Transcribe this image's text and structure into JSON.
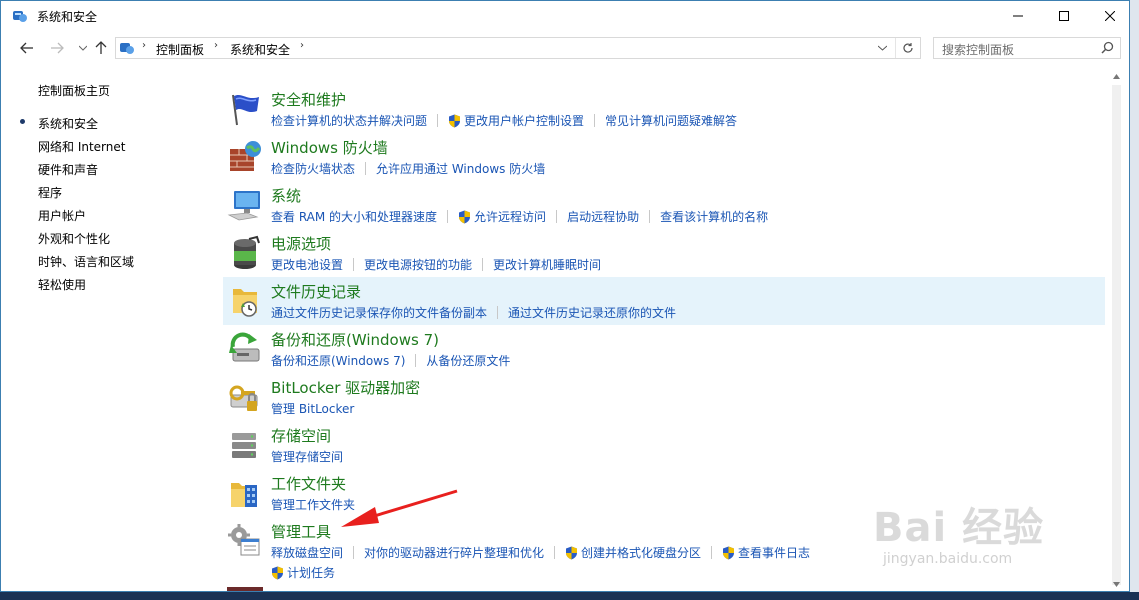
{
  "window": {
    "title": "系统和安全"
  },
  "address": {
    "crumbs": [
      "控制面板",
      "系统和安全"
    ]
  },
  "search": {
    "placeholder": "搜索控制面板"
  },
  "sidebar": {
    "home": "控制面板主页",
    "items": [
      {
        "label": "系统和安全",
        "current": true
      },
      {
        "label": "网络和 Internet"
      },
      {
        "label": "硬件和声音"
      },
      {
        "label": "程序"
      },
      {
        "label": "用户帐户"
      },
      {
        "label": "外观和个性化"
      },
      {
        "label": "时钟、语言和区域"
      },
      {
        "label": "轻松使用"
      }
    ]
  },
  "categories": [
    {
      "title": "安全和维护",
      "icon": "flag-icon",
      "links": [
        {
          "text": "检查计算机的状态并解决问题"
        },
        {
          "text": "更改用户帐户控制设置",
          "shield": true
        },
        {
          "text": "常见计算机问题疑难解答"
        }
      ]
    },
    {
      "title": "Windows 防火墙",
      "icon": "firewall-icon",
      "links": [
        {
          "text": "检查防火墙状态"
        },
        {
          "text": "允许应用通过 Windows 防火墙"
        }
      ]
    },
    {
      "title": "系统",
      "icon": "computer-icon",
      "links": [
        {
          "text": "查看 RAM 的大小和处理器速度"
        },
        {
          "text": "允许远程访问",
          "shield": true
        },
        {
          "text": "启动远程协助"
        },
        {
          "text": "查看该计算机的名称"
        }
      ]
    },
    {
      "title": "电源选项",
      "icon": "battery-icon",
      "links": [
        {
          "text": "更改电池设置"
        },
        {
          "text": "更改电源按钮的功能"
        },
        {
          "text": "更改计算机睡眠时间"
        }
      ]
    },
    {
      "title": "文件历史记录",
      "icon": "file-history-icon",
      "highlight": true,
      "links": [
        {
          "text": "通过文件历史记录保存你的文件备份副本"
        },
        {
          "text": "通过文件历史记录还原你的文件"
        }
      ]
    },
    {
      "title": "备份和还原(Windows 7)",
      "icon": "backup-icon",
      "links": [
        {
          "text": "备份和还原(Windows 7)"
        },
        {
          "text": "从备份还原文件"
        }
      ]
    },
    {
      "title": "BitLocker 驱动器加密",
      "icon": "bitlocker-icon",
      "links": [
        {
          "text": "管理 BitLocker"
        }
      ]
    },
    {
      "title": "存储空间",
      "icon": "storage-icon",
      "links": [
        {
          "text": "管理存储空间"
        }
      ]
    },
    {
      "title": "工作文件夹",
      "icon": "work-folder-icon",
      "links": [
        {
          "text": "管理工作文件夹"
        }
      ]
    },
    {
      "title": "管理工具",
      "icon": "admin-tools-icon",
      "links": [
        {
          "text": "释放磁盘空间"
        },
        {
          "text": "对你的驱动器进行碎片整理和优化"
        },
        {
          "text": "创建并格式化硬盘分区",
          "shield": true
        },
        {
          "text": "查看事件日志",
          "shield": true
        }
      ],
      "links2": [
        {
          "text": "计划任务",
          "shield": true
        }
      ]
    }
  ],
  "watermark": {
    "brand": "Bai 经验",
    "url": "jingyan.baidu.com"
  },
  "colors": {
    "title_green": "#1e7a1e",
    "link_blue": "#1a55b4",
    "highlight": "#e5f3fb",
    "arrow_red": "#e8201e"
  }
}
